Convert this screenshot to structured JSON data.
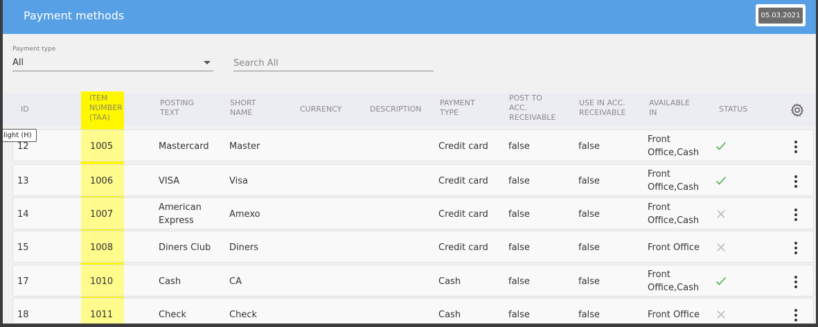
{
  "header": {
    "title": "Payment methods",
    "date": "05.03.2021"
  },
  "filters": {
    "payment_type_label": "Payment type",
    "payment_type_value": "All",
    "search_placeholder": "Search All"
  },
  "table": {
    "columns": {
      "id": "ID",
      "item_number": [
        "ITEM",
        "NUMBER",
        "(TAA)"
      ],
      "posting_text": [
        "POSTING",
        "TEXT"
      ],
      "short_name": [
        "SHORT",
        "NAME"
      ],
      "currency": "CURRENCY",
      "description": "DESCRIPTION",
      "payment_type": [
        "PAYMENT",
        "TYPE"
      ],
      "post_to": [
        "POST TO",
        "ACC.",
        "RECEIVABLE"
      ],
      "use_in": [
        "USE IN ACC.",
        "RECEIVABLE"
      ],
      "available_in": [
        "AVAILABLE",
        "IN"
      ],
      "status": "STATUS"
    },
    "rows": [
      {
        "id": "12",
        "item": "1005",
        "posting": [
          "Mastercard"
        ],
        "short": "Master",
        "currency": "",
        "description": "",
        "type": "Credit card",
        "post": "false",
        "use": "false",
        "available": [
          "Front",
          "Office,Cash"
        ],
        "status": "active"
      },
      {
        "id": "13",
        "item": "1006",
        "posting": [
          "VISA"
        ],
        "short": "Visa",
        "currency": "",
        "description": "",
        "type": "Credit card",
        "post": "false",
        "use": "false",
        "available": [
          "Front",
          "Office,Cash"
        ],
        "status": "active"
      },
      {
        "id": "14",
        "item": "1007",
        "posting": [
          "American",
          "Express"
        ],
        "short": "Amexo",
        "currency": "",
        "description": "",
        "type": "Credit card",
        "post": "false",
        "use": "false",
        "available": [
          "Front",
          "Office,Cash"
        ],
        "status": "inactive"
      },
      {
        "id": "15",
        "item": "1008",
        "posting": [
          "Diners Club"
        ],
        "short": "Diners",
        "currency": "",
        "description": "",
        "type": "Credit card",
        "post": "false",
        "use": "false",
        "available": [
          "Front Office"
        ],
        "status": "inactive"
      },
      {
        "id": "17",
        "item": "1010",
        "posting": [
          "Cash"
        ],
        "short": "CA",
        "currency": "",
        "description": "",
        "type": "Cash",
        "post": "false",
        "use": "false",
        "available": [
          "Front",
          "Office,Cash"
        ],
        "status": "active"
      },
      {
        "id": "18",
        "item": "1011",
        "posting": [
          "Check"
        ],
        "short": "Check",
        "currency": "",
        "description": "",
        "type": "Cash",
        "post": "false",
        "use": "false",
        "available": [
          "Front Office"
        ],
        "status": "inactive"
      }
    ]
  },
  "tooltip": "light (H)",
  "colors": {
    "header": "#57a0e5",
    "highlight": "#fff700",
    "check": "#4caf50",
    "cross": "#bdbdbd"
  },
  "icons": {
    "settings": "gear-icon",
    "row_menu": "more-vert-icon",
    "active": "check-icon",
    "inactive": "close-icon",
    "dropdown": "chevron-down-icon"
  }
}
